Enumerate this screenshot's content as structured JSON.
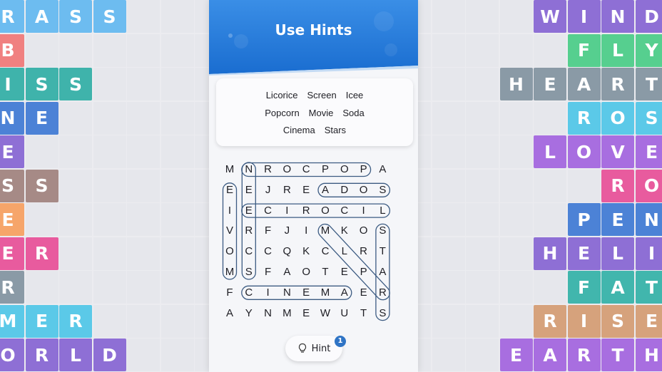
{
  "banner": {
    "title": "Use Hints"
  },
  "word_list": [
    [
      "Licorice",
      "Screen",
      "Icee"
    ],
    [
      "Popcorn",
      "Movie",
      "Soda"
    ],
    [
      "Cinema",
      "Stars"
    ]
  ],
  "letter_grid": [
    "MNROCPOPA",
    "EEJREADOS",
    "IECIROCIL",
    "VRFJIMKOS",
    "OCCQKCLRT",
    "MSFAOTEPA",
    "FCINEMAER",
    "AYNMEWUTS"
  ],
  "hint_button": {
    "label": "Hint",
    "count": "1"
  },
  "colors": {
    "purple": "#8e6fd5",
    "violet": "#a86ee0",
    "teal": "#3fb3ab",
    "green": "#56cf8f",
    "skyblue": "#5bc9e8",
    "blue": "#4c82d6",
    "pink": "#e85b9e",
    "salmon": "#f08080",
    "orange": "#f6a56a",
    "gray": "#8a9aa6",
    "taupe": "#a68a86",
    "lightblue": "#6dbcf0",
    "tan": "#d6a27c",
    "teal2": "#41b6ad"
  },
  "left_tiles": [
    {
      "row": 0,
      "start": -1,
      "letters": "GRASS",
      "colors": [
        "lightblue",
        "lightblue",
        "lightblue",
        "lightblue",
        "lightblue"
      ]
    },
    {
      "row": 1,
      "start": -1,
      "letters": "AB",
      "colors": [
        "salmon",
        "salmon"
      ]
    },
    {
      "row": 2,
      "start": -1,
      "letters": "KISS",
      "colors": [
        "teal",
        "teal",
        "teal",
        "teal"
      ]
    },
    {
      "row": 3,
      "start": -1,
      "letters": "INE",
      "colors": [
        "blue",
        "blue",
        "blue"
      ]
    },
    {
      "row": 4,
      "start": -1,
      "letters": "WE",
      "colors": [
        "purple",
        "purple"
      ]
    },
    {
      "row": 5,
      "start": -1,
      "letters": "ESS",
      "colors": [
        "taupe",
        "taupe",
        "taupe"
      ]
    },
    {
      "row": 6,
      "start": -1,
      "letters": "NE",
      "colors": [
        "orange",
        "orange"
      ]
    },
    {
      "row": 7,
      "start": -1,
      "letters": "GER",
      "colors": [
        "pink",
        "pink",
        "pink"
      ]
    },
    {
      "row": 8,
      "start": -1,
      "letters": "ER",
      "colors": [
        "gray",
        "gray"
      ]
    },
    {
      "row": 9,
      "start": -1,
      "letters": "MMER",
      "colors": [
        "skyblue",
        "skyblue",
        "skyblue",
        "skyblue"
      ]
    },
    {
      "row": 10,
      "start": -1,
      "letters": "WORLD",
      "colors": [
        "purple",
        "purple",
        "purple",
        "purple",
        "purple"
      ]
    }
  ],
  "right_tiles": [
    {
      "row": 0,
      "start": 16,
      "letters": "WIND",
      "colors": [
        "purple",
        "purple",
        "purple",
        "purple"
      ]
    },
    {
      "row": 1,
      "start": 17,
      "letters": "FLY",
      "colors": [
        "green",
        "green",
        "green"
      ]
    },
    {
      "row": 2,
      "start": 15,
      "letters": "HEART",
      "colors": [
        "gray",
        "gray",
        "gray",
        "gray",
        "gray"
      ]
    },
    {
      "row": 3,
      "start": 17,
      "letters": "ROS",
      "colors": [
        "skyblue",
        "skyblue",
        "skyblue"
      ]
    },
    {
      "row": 4,
      "start": 16,
      "letters": "LOVE",
      "colors": [
        "violet",
        "violet",
        "violet",
        "violet"
      ]
    },
    {
      "row": 5,
      "start": 18,
      "letters": "RO",
      "colors": [
        "pink",
        "pink"
      ]
    },
    {
      "row": 6,
      "start": 17,
      "letters": "PEN",
      "colors": [
        "blue",
        "blue",
        "blue"
      ]
    },
    {
      "row": 7,
      "start": 16,
      "letters": "HELI",
      "colors": [
        "purple",
        "purple",
        "purple",
        "purple"
      ]
    },
    {
      "row": 8,
      "start": 17,
      "letters": "FAT",
      "colors": [
        "teal2",
        "teal2",
        "teal2"
      ]
    },
    {
      "row": 9,
      "start": 16,
      "letters": "RISE",
      "colors": [
        "tan",
        "tan",
        "tan",
        "tan"
      ]
    },
    {
      "row": 10,
      "start": 15,
      "letters": "EARTH",
      "colors": [
        "violet",
        "violet",
        "violet",
        "violet",
        "violet"
      ]
    }
  ],
  "found_word_paths": [
    {
      "word": "POPCORN",
      "from": [
        0,
        7
      ],
      "to": [
        0,
        1
      ]
    },
    {
      "word": "SODA",
      "from": [
        1,
        8
      ],
      "to": [
        1,
        5
      ]
    },
    {
      "word": "LICORICE",
      "from": [
        2,
        8
      ],
      "to": [
        2,
        1
      ]
    },
    {
      "word": "MOVIE",
      "from": [
        5,
        0
      ],
      "to": [
        1,
        0
      ]
    },
    {
      "word": "NRCCS",
      "from": [
        0,
        1
      ],
      "to": [
        5,
        1
      ]
    },
    {
      "word": "ICLEE",
      "from": [
        3,
        5
      ],
      "to": [
        6,
        8
      ]
    },
    {
      "word": "CINEMA",
      "from": [
        6,
        1
      ],
      "to": [
        6,
        6
      ]
    },
    {
      "word": "STARS",
      "from": [
        3,
        9
      ],
      "to": [
        7,
        9
      ]
    }
  ]
}
